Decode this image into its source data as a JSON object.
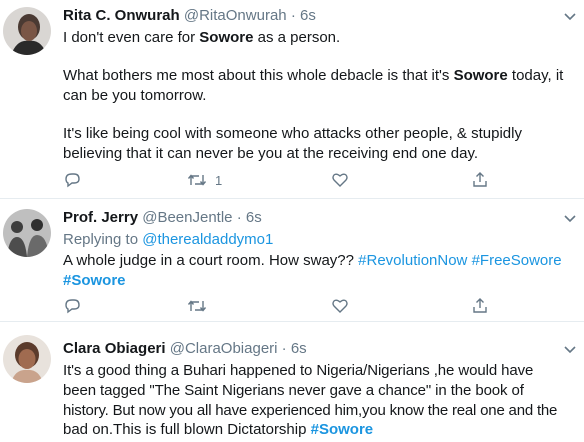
{
  "tweets": [
    {
      "name": "Rita C. Onwurah",
      "handle": "@RitaOnwurah",
      "sep": "·",
      "time": "6s",
      "lines": [
        {
          "a": "I don't even care for ",
          "b": "Sowore",
          "c": " as a person."
        },
        {
          "a": "What bothers me most about this whole debacle is that it's ",
          "b": "Sowore",
          "c": " today, it"
        },
        {
          "a": "can be you tomorrow."
        },
        {
          "a": "It's like being cool with someone who attacks other people, & stupidly"
        },
        {
          "a": "believing that it can never be you at the receiving end one day."
        }
      ],
      "retweet_count": "1"
    },
    {
      "name": "Prof. Jerry",
      "handle": "@BeenJentle",
      "sep": "·",
      "time": "6s",
      "replying_prefix": "Replying to ",
      "replying_to": "@therealdaddymo1",
      "line1_text": "A whole judge in a court room. How sway?? ",
      "tag1": "#RevolutionNow",
      "tag2": "#FreeSowore",
      "tag3": "#Sowore"
    },
    {
      "name": "Clara Obiageri",
      "handle": "@ClaraObiageri",
      "sep": "·",
      "time": "6s",
      "lines": [
        "It's a good thing a Buhari happened to Nigeria/Nigerians ,he would have",
        "been tagged \"The Saint Nigerians never gave a chance\" in the book of",
        "history. But now you all have experienced him,you know the real one and the"
      ],
      "last_line": "bad on.This is full blown Dictatorship ",
      "last_tag": "#Sowore"
    }
  ],
  "icons": [
    "reply-icon",
    "retweet-icon",
    "like-icon",
    "share-icon",
    "chevron-down-icon"
  ],
  "colors": {
    "text": "#14171a",
    "muted": "#657786",
    "link": "#1b95e0",
    "divider": "#e6ecf0"
  }
}
